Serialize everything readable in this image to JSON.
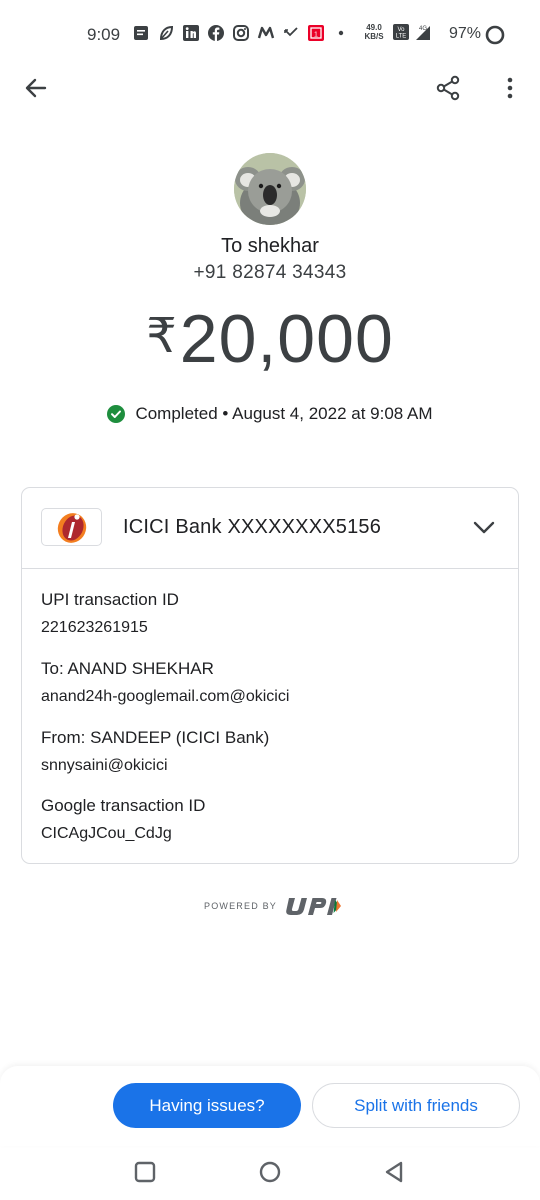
{
  "status_bar": {
    "time": "9:09",
    "net_speed_value": "49.0",
    "net_speed_unit": "KB/S",
    "network": "4G",
    "battery": "97%"
  },
  "app_bar": {
    "back_icon": "arrow-left-icon",
    "share_icon": "share-icon",
    "more_icon": "more-vert-icon"
  },
  "transaction": {
    "recipient_label": "To shekhar",
    "recipient_phone": "+91 82874 34343",
    "currency_symbol": "₹",
    "amount": "20,000",
    "status": "Completed",
    "separator": "•",
    "datetime": "August 4, 2022 at 9:08 AM"
  },
  "details": {
    "bank_account": "ICICI Bank XXXXXXXX5156",
    "items": [
      {
        "label": "UPI transaction ID",
        "value": "221623261915"
      },
      {
        "label": "To: ANAND SHEKHAR",
        "value": "anand24h-googlemail.com@okicici"
      },
      {
        "label": "From: SANDEEP (ICICI Bank)",
        "value": "snnysaini@okicici"
      },
      {
        "label": "Google transaction ID",
        "value": "CICAgJCou_CdJg"
      }
    ]
  },
  "footer": {
    "powered_by": "POWERED BY"
  },
  "actions": {
    "issues_label": "Having issues?",
    "split_label": "Split with friends"
  },
  "colors": {
    "accent": "#1a73e8",
    "success": "#1e8e3e",
    "border": "#dadce0"
  }
}
